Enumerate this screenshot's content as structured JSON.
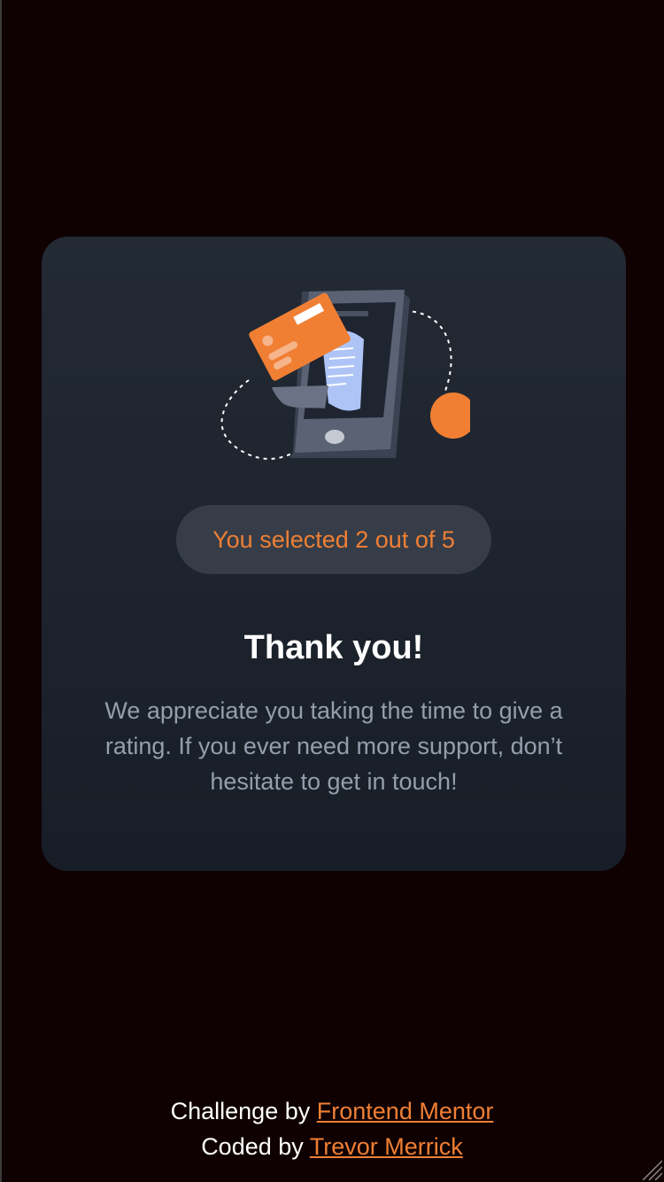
{
  "card": {
    "selection_text": "You selected 2 out of 5",
    "title": "Thank you!",
    "message": "We appreciate you taking the time to give a rating. If you ever need more support, don’t hesitate to get in touch!"
  },
  "rating": {
    "selected": 2,
    "max": 5
  },
  "attribution": {
    "challenge_prefix": "Challenge by",
    "challenge_link": "Frontend Mentor",
    "coded_prefix": "Coded by",
    "coded_link": "Trevor Merrick"
  },
  "colors": {
    "background": "#0f0102",
    "card_top": "#232a34",
    "card_bottom": "#181e27",
    "accent": "#f07f34",
    "badge_bg": "#363d48",
    "muted_text": "#959eac",
    "text": "#ffffff"
  },
  "icons": {
    "illustration": "phone-payment-illustration",
    "resize": "resize-grip-icon"
  }
}
